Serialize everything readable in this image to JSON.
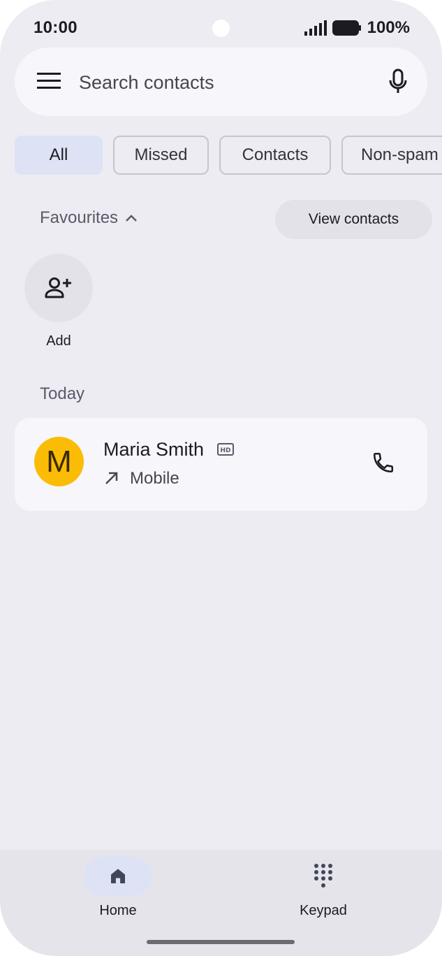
{
  "status_bar": {
    "time": "10:00",
    "battery": "100%"
  },
  "search": {
    "placeholder": "Search contacts"
  },
  "chips": [
    {
      "label": "All",
      "active": true
    },
    {
      "label": "Missed",
      "active": false
    },
    {
      "label": "Contacts",
      "active": false
    },
    {
      "label": "Non-spam",
      "active": false
    }
  ],
  "favourites": {
    "label": "Favourites",
    "view_contacts": "View contacts",
    "add_label": "Add"
  },
  "today": {
    "label": "Today",
    "calls": [
      {
        "initial": "M",
        "name": "Maria Smith",
        "type": "Mobile",
        "avatar_color": "#fbbc05",
        "badge": "HD"
      }
    ]
  },
  "bottom_nav": {
    "items": [
      {
        "label": "Home",
        "icon": "home-icon",
        "active": true
      },
      {
        "label": "Keypad",
        "icon": "dialpad-icon",
        "active": false
      }
    ]
  }
}
